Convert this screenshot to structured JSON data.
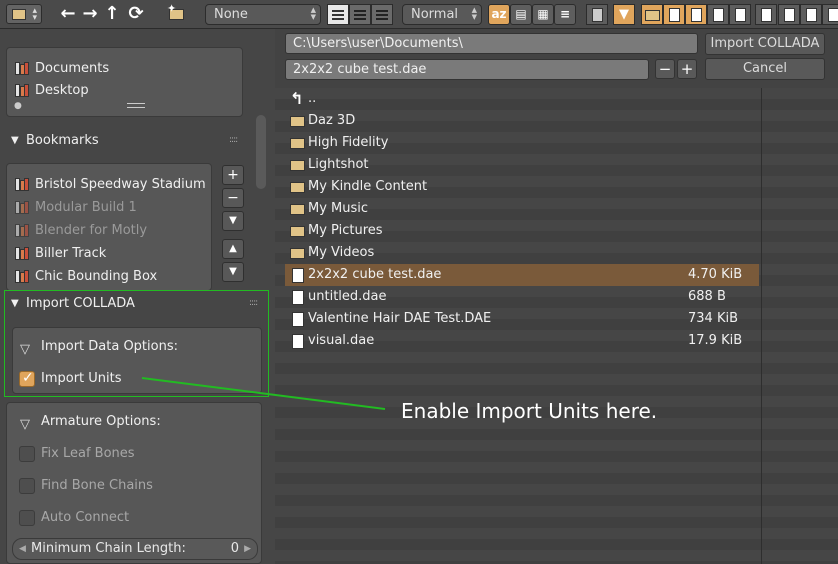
{
  "header": {
    "display_mode": "None",
    "sort_mode": "Normal",
    "sort_buttons": [
      "az-sort-icon",
      "extension-sort-icon",
      "date-sort-icon",
      "size-sort-icon"
    ]
  },
  "left_panel": {
    "system_items": [
      "Documents",
      "Desktop"
    ],
    "bookmarks_title": "Bookmarks",
    "bookmarks": [
      {
        "label": "Bristol Speedway Stadium",
        "dim": false
      },
      {
        "label": "Modular Build 1",
        "dim": true
      },
      {
        "label": "Blender for Motly",
        "dim": true
      },
      {
        "label": "Biller Track",
        "dim": false
      },
      {
        "label": "Chic Bounding Box",
        "dim": false
      }
    ],
    "import_title": "Import COLLADA",
    "import_data_options": "Import Data Options:",
    "import_units": {
      "label": "Import Units",
      "checked": true
    },
    "armature_options": "Armature Options:",
    "armature_checks": [
      {
        "label": "Fix Leaf Bones",
        "checked": false
      },
      {
        "label": "Find Bone Chains",
        "checked": false
      },
      {
        "label": "Auto Connect",
        "checked": false
      }
    ],
    "min_chain": {
      "label": "Minimum Chain Length:",
      "value": "0"
    }
  },
  "right_panel": {
    "directory": "C:\\Users\\user\\Documents\\",
    "filename": "2x2x2 cube test.dae",
    "import_button": "Import COLLADA",
    "cancel_button": "Cancel",
    "minus": "−",
    "plus": "+",
    "files": [
      {
        "name": "..",
        "type": "parent",
        "size": ""
      },
      {
        "name": "Daz 3D",
        "type": "folder",
        "size": ""
      },
      {
        "name": "High Fidelity",
        "type": "folder",
        "size": ""
      },
      {
        "name": "Lightshot",
        "type": "folder",
        "size": ""
      },
      {
        "name": "My Kindle Content",
        "type": "folder",
        "size": ""
      },
      {
        "name": "My Music",
        "type": "folder",
        "size": ""
      },
      {
        "name": "My Pictures",
        "type": "folder",
        "size": ""
      },
      {
        "name": "My Videos",
        "type": "folder",
        "size": ""
      },
      {
        "name": "2x2x2 cube test.dae",
        "type": "file",
        "size": "4.70 KiB",
        "selected": true
      },
      {
        "name": "untitled.dae",
        "type": "file",
        "size": "688 B"
      },
      {
        "name": "Valentine Hair DAE Test.DAE",
        "type": "file",
        "size": "734 KiB"
      },
      {
        "name": "visual.dae",
        "type": "file",
        "size": "17.9 KiB"
      }
    ]
  },
  "annotation": {
    "text": "Enable Import Units here.",
    "color": "#22bb22"
  }
}
